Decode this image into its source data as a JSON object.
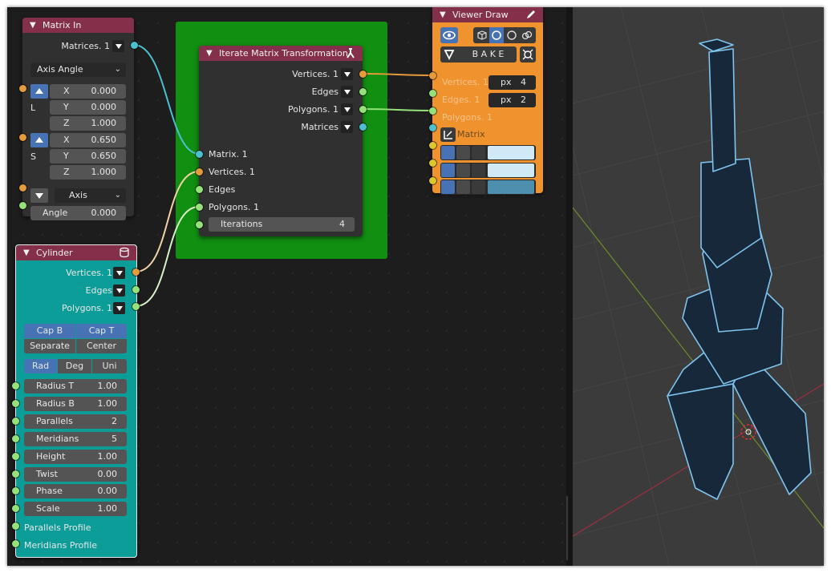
{
  "matrix_in": {
    "title": "Matrix In",
    "output": "Matrices. 1",
    "mode": "Axis Angle",
    "loc_label": "L",
    "loc": [
      {
        "k": "X",
        "v": "0.000"
      },
      {
        "k": "Y",
        "v": "0.000"
      },
      {
        "k": "Z",
        "v": "1.000"
      }
    ],
    "scale_label": "S",
    "scale": [
      {
        "k": "X",
        "v": "0.650"
      },
      {
        "k": "Y",
        "v": "0.650"
      },
      {
        "k": "Z",
        "v": "1.000"
      }
    ],
    "axis": "Axis",
    "angle_label": "Angle",
    "angle_value": "0.000"
  },
  "iterate": {
    "title": "Iterate Matrix Transformation",
    "outputs": [
      "Vertices. 1",
      "Edges",
      "Polygons. 1",
      "Matrices"
    ],
    "inputs": [
      "Matrix. 1",
      "Vertices. 1",
      "Edges",
      "Polygons. 1"
    ],
    "iterations_label": "Iterations",
    "iterations_value": "4"
  },
  "viewer": {
    "title": "Viewer Draw",
    "bake": "B A K E",
    "inputs": [
      "Vertices. 1",
      "Edges. 1",
      "Polygons. 1",
      "Matrix"
    ],
    "vert_px_unit": "px",
    "vert_px": "4",
    "edge_px_unit": "px",
    "edge_px": "2",
    "colors": [
      "#cfe9f7",
      "#cfe9f7",
      "#4e8fb0"
    ]
  },
  "cylinder": {
    "title": "Cylinder",
    "outputs": [
      "Vertices. 1",
      "Edges",
      "Polygons. 1"
    ],
    "cap_b": "Cap B",
    "cap_t": "Cap T",
    "separate": "Separate",
    "center": "Center",
    "units": [
      "Rad",
      "Deg",
      "Uni"
    ],
    "params": [
      {
        "k": "Radius T",
        "v": "1.00"
      },
      {
        "k": "Radius B",
        "v": "1.00"
      },
      {
        "k": "Parallels",
        "v": "2"
      },
      {
        "k": "Meridians",
        "v": "5"
      },
      {
        "k": "Height",
        "v": "1.00"
      },
      {
        "k": "Twist",
        "v": "0.00"
      },
      {
        "k": "Phase",
        "v": "0.00"
      },
      {
        "k": "Scale",
        "v": "1.00"
      }
    ],
    "profiles": [
      "Parallels Profile",
      "Meridians Profile"
    ]
  },
  "colors": {
    "matrix_header": "#85304a",
    "iterate_header": "#85304a",
    "viewer_body": "#f0932f",
    "cylinder_body": "#0d9d98",
    "frame_green": "#118f11",
    "accent_blue": "#4772b3"
  }
}
